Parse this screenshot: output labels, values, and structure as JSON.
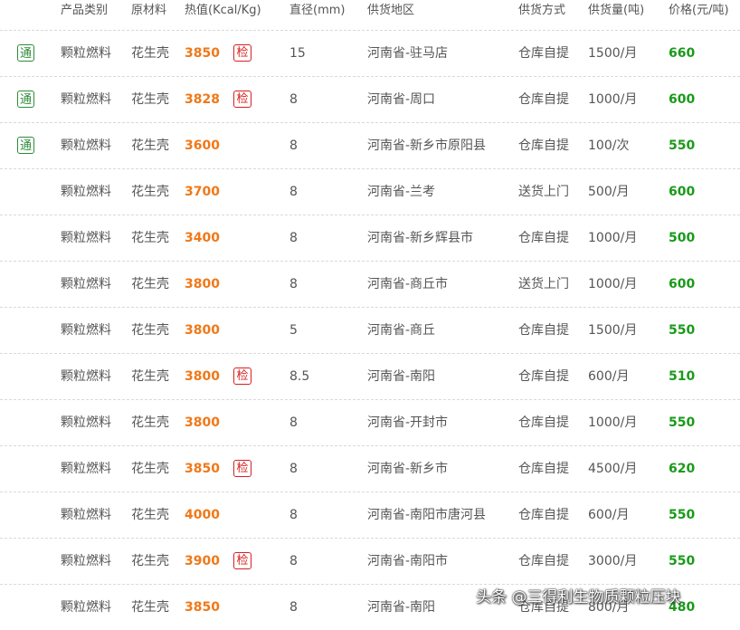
{
  "header": {
    "category": "产品类别",
    "material": "原材料",
    "heat": "热值(Kcal/Kg)",
    "diameter": "直径(mm)",
    "region": "供货地区",
    "delivery": "供货方式",
    "supply": "供货量(吨)",
    "price": "价格(元/吨)"
  },
  "badges": {
    "tong": "通",
    "jian": "检"
  },
  "rows": [
    {
      "tong": true,
      "category": "颗粒燃料",
      "material": "花生壳",
      "heat": "3850",
      "jian": true,
      "diameter": "15",
      "region": "河南省-驻马店",
      "delivery": "仓库自提",
      "supply": "1500/月",
      "price": "660"
    },
    {
      "tong": true,
      "category": "颗粒燃料",
      "material": "花生壳",
      "heat": "3828",
      "jian": true,
      "diameter": "8",
      "region": "河南省-周口",
      "delivery": "仓库自提",
      "supply": "1000/月",
      "price": "600"
    },
    {
      "tong": true,
      "category": "颗粒燃料",
      "material": "花生壳",
      "heat": "3600",
      "jian": false,
      "diameter": "8",
      "region": "河南省-新乡市原阳县",
      "delivery": "仓库自提",
      "supply": "100/次",
      "price": "550"
    },
    {
      "tong": false,
      "category": "颗粒燃料",
      "material": "花生壳",
      "heat": "3700",
      "jian": false,
      "diameter": "8",
      "region": "河南省-兰考",
      "delivery": "送货上门",
      "supply": "500/月",
      "price": "600"
    },
    {
      "tong": false,
      "category": "颗粒燃料",
      "material": "花生壳",
      "heat": "3400",
      "jian": false,
      "diameter": "8",
      "region": "河南省-新乡辉县市",
      "delivery": "仓库自提",
      "supply": "1000/月",
      "price": "500"
    },
    {
      "tong": false,
      "category": "颗粒燃料",
      "material": "花生壳",
      "heat": "3800",
      "jian": false,
      "diameter": "8",
      "region": "河南省-商丘市",
      "delivery": "送货上门",
      "supply": "1000/月",
      "price": "600"
    },
    {
      "tong": false,
      "category": "颗粒燃料",
      "material": "花生壳",
      "heat": "3800",
      "jian": false,
      "diameter": "5",
      "region": "河南省-商丘",
      "delivery": "仓库自提",
      "supply": "1500/月",
      "price": "550"
    },
    {
      "tong": false,
      "category": "颗粒燃料",
      "material": "花生壳",
      "heat": "3800",
      "jian": true,
      "diameter": "8.5",
      "region": "河南省-南阳",
      "delivery": "仓库自提",
      "supply": "600/月",
      "price": "510"
    },
    {
      "tong": false,
      "category": "颗粒燃料",
      "material": "花生壳",
      "heat": "3800",
      "jian": false,
      "diameter": "8",
      "region": "河南省-开封市",
      "delivery": "仓库自提",
      "supply": "1000/月",
      "price": "550"
    },
    {
      "tong": false,
      "category": "颗粒燃料",
      "material": "花生壳",
      "heat": "3850",
      "jian": true,
      "diameter": "8",
      "region": "河南省-新乡市",
      "delivery": "仓库自提",
      "supply": "4500/月",
      "price": "620"
    },
    {
      "tong": false,
      "category": "颗粒燃料",
      "material": "花生壳",
      "heat": "4000",
      "jian": false,
      "diameter": "8",
      "region": "河南省-南阳市唐河县",
      "delivery": "仓库自提",
      "supply": "600/月",
      "price": "550"
    },
    {
      "tong": false,
      "category": "颗粒燃料",
      "material": "花生壳",
      "heat": "3900",
      "jian": true,
      "diameter": "8",
      "region": "河南省-南阳市",
      "delivery": "仓库自提",
      "supply": "3000/月",
      "price": "550"
    },
    {
      "tong": false,
      "category": "颗粒燃料",
      "material": "花生壳",
      "heat": "3850",
      "jian": false,
      "diameter": "8",
      "region": "河南省-南阳",
      "delivery": "仓库自提",
      "supply": "800/月",
      "price": "480"
    }
  ],
  "watermark": "头条 @三得利生物质颗粒压块",
  "colors": {
    "heat": "#f07818",
    "price": "#1a9a1a",
    "tong_badge": "#2e8b3a",
    "jian_badge": "#d62020"
  }
}
